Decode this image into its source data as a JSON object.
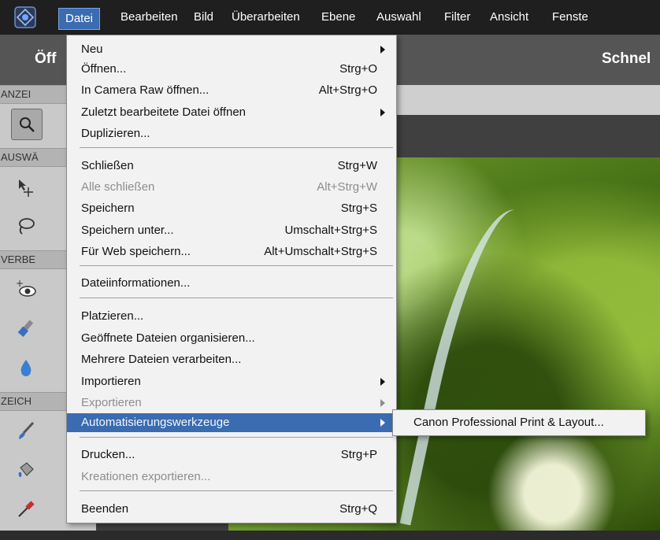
{
  "menubar": {
    "items": [
      "Datei",
      "Bearbeiten",
      "Bild",
      "Überarbeiten",
      "Ebene",
      "Auswahl",
      "Filter",
      "Ansicht",
      "Fenste"
    ],
    "active_index": 0
  },
  "titlebar": {
    "open_label": "Öff",
    "mode_label": "Schnel"
  },
  "toolpanel": {
    "sections": [
      "ANZEI",
      "AUSWÄ",
      "VERBE",
      "ZEICH"
    ],
    "icons": [
      "zoom-icon",
      "move-icon",
      "lasso-icon",
      "red-eye-icon",
      "brush-fix-icon",
      "drop-icon",
      "paintbrush-icon",
      "paint-bucket-icon",
      "eyedropper-icon"
    ]
  },
  "file_menu": {
    "items": [
      {
        "label": "Neu",
        "shortcut": "",
        "submenu": true,
        "disabled": false
      },
      {
        "label": "Öffnen...",
        "shortcut": "Strg+O",
        "submenu": false,
        "disabled": false
      },
      {
        "label": "In Camera Raw öffnen...",
        "shortcut": "Alt+Strg+O",
        "submenu": false,
        "disabled": false
      },
      {
        "label": "Zuletzt bearbeitete Datei öffnen",
        "shortcut": "",
        "submenu": true,
        "disabled": false
      },
      {
        "label": "Duplizieren...",
        "shortcut": "",
        "submenu": false,
        "disabled": false
      },
      {
        "label": "Schließen",
        "shortcut": "Strg+W",
        "submenu": false,
        "disabled": false
      },
      {
        "label": "Alle schließen",
        "shortcut": "Alt+Strg+W",
        "submenu": false,
        "disabled": true
      },
      {
        "label": "Speichern",
        "shortcut": "Strg+S",
        "submenu": false,
        "disabled": false
      },
      {
        "label": "Speichern unter...",
        "shortcut": "Umschalt+Strg+S",
        "submenu": false,
        "disabled": false
      },
      {
        "label": "Für Web speichern...",
        "shortcut": "Alt+Umschalt+Strg+S",
        "submenu": false,
        "disabled": false
      },
      {
        "label": "Dateiinformationen...",
        "shortcut": "",
        "submenu": false,
        "disabled": false
      },
      {
        "label": "Platzieren...",
        "shortcut": "",
        "submenu": false,
        "disabled": false
      },
      {
        "label": "Geöffnete Dateien organisieren...",
        "shortcut": "",
        "submenu": false,
        "disabled": false
      },
      {
        "label": "Mehrere Dateien verarbeiten...",
        "shortcut": "",
        "submenu": false,
        "disabled": false
      },
      {
        "label": "Importieren",
        "shortcut": "",
        "submenu": true,
        "disabled": false
      },
      {
        "label": "Exportieren",
        "shortcut": "",
        "submenu": true,
        "disabled": true
      },
      {
        "label": "Automatisierungswerkzeuge",
        "shortcut": "",
        "submenu": true,
        "disabled": false,
        "highlighted": true
      },
      {
        "label": "Drucken...",
        "shortcut": "Strg+P",
        "submenu": false,
        "disabled": false
      },
      {
        "label": "Kreationen exportieren...",
        "shortcut": "",
        "submenu": false,
        "disabled": true
      },
      {
        "label": "Beenden",
        "shortcut": "Strg+Q",
        "submenu": false,
        "disabled": false
      }
    ]
  },
  "submenu": {
    "items": [
      "Canon Professional Print & Layout..."
    ]
  },
  "colors": {
    "highlight": "#3b6bb0",
    "menubar": "#1f1f1f",
    "menu_bg": "#f2f2f2",
    "disabled_text": "#8d8d8d"
  }
}
